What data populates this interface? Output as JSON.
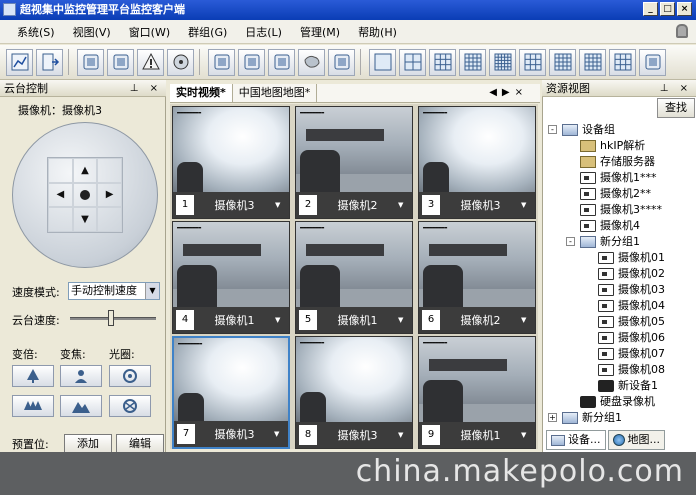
{
  "window": {
    "title": "超视集中监控管理平台监控客户端",
    "controls": [
      "_",
      "□",
      "×"
    ]
  },
  "menu": [
    "系统(S)",
    "视图(V)",
    "窗口(W)",
    "群组(G)",
    "日志(L)",
    "管理(M)",
    "帮助(H)"
  ],
  "toolbar": {
    "icons": [
      "chart-icon",
      "exit-icon",
      "log-icon",
      "edit-icon",
      "alarm-icon",
      "disk-icon",
      "settings-icon",
      "camera-add-icon",
      "device-icon",
      "map-icon",
      "export-icon",
      "layout-1-icon",
      "layout-4-icon",
      "layout-9-icon",
      "layout-16-icon",
      "layout-25-icon",
      "layout-6-icon",
      "layout-8-icon",
      "layout-13-icon",
      "layout-custom-icon",
      "more-icon"
    ]
  },
  "ptz": {
    "panel_title": "云台控制",
    "camera_label": "摄像机：摄像机3",
    "speed_mode_label": "速度模式:",
    "speed_mode_value": "手动控制速度",
    "speed_label": "云台速度:",
    "zoom_label": "变倍:",
    "focus_label": "变焦:",
    "iris_label": "光圈:",
    "preset_label": "预置位:",
    "add_button": "添加",
    "edit_button": "编辑"
  },
  "tabs": [
    {
      "label": "实时视频*",
      "active": true
    },
    {
      "label": "中国地图地图*",
      "active": false
    }
  ],
  "video_cells": [
    {
      "num": "1",
      "name": "摄像机3",
      "scene": "bright"
    },
    {
      "num": "2",
      "name": "摄像机2",
      "scene": "room"
    },
    {
      "num": "3",
      "name": "摄像机3",
      "scene": "bright"
    },
    {
      "num": "4",
      "name": "摄像机1",
      "scene": "room"
    },
    {
      "num": "5",
      "name": "摄像机1",
      "scene": "room"
    },
    {
      "num": "6",
      "name": "摄像机2",
      "scene": "room"
    },
    {
      "num": "7",
      "name": "摄像机3",
      "scene": "bright"
    },
    {
      "num": "8",
      "name": "摄像机3",
      "scene": "bright"
    },
    {
      "num": "9",
      "name": "摄像机1",
      "scene": "room"
    }
  ],
  "resources": {
    "panel_title": "资源视图",
    "search_button": "查找",
    "tree": [
      {
        "label": "设备组",
        "level": 0,
        "icon": "group",
        "expander": "-"
      },
      {
        "label": "hkIP解析",
        "level": 1,
        "icon": "server"
      },
      {
        "label": "存储服务器",
        "level": 1,
        "icon": "server"
      },
      {
        "label": "摄像机1***",
        "level": 1,
        "icon": "camera"
      },
      {
        "label": "摄像机2**",
        "level": 1,
        "icon": "camera"
      },
      {
        "label": "摄像机3****",
        "level": 1,
        "icon": "camera"
      },
      {
        "label": "摄像机4",
        "level": 1,
        "icon": "camera"
      },
      {
        "label": "新分组1",
        "level": 1,
        "icon": "group",
        "expander": "-"
      },
      {
        "label": "摄像机01",
        "level": 2,
        "icon": "camera"
      },
      {
        "label": "摄像机02",
        "level": 2,
        "icon": "camera"
      },
      {
        "label": "摄像机03",
        "level": 2,
        "icon": "camera"
      },
      {
        "label": "摄像机04",
        "level": 2,
        "icon": "camera"
      },
      {
        "label": "摄像机05",
        "level": 2,
        "icon": "camera"
      },
      {
        "label": "摄像机06",
        "level": 2,
        "icon": "camera"
      },
      {
        "label": "摄像机07",
        "level": 2,
        "icon": "camera"
      },
      {
        "label": "摄像机08",
        "level": 2,
        "icon": "camera"
      },
      {
        "label": "新设备1",
        "level": 2,
        "icon": "recorder"
      },
      {
        "label": "硬盘录像机",
        "level": 1,
        "icon": "recorder"
      },
      {
        "label": "新分组1",
        "level": 0,
        "icon": "group",
        "expander": "+"
      }
    ],
    "bottom_tabs": [
      "设备...",
      "地图..."
    ]
  },
  "watermark": "china.makepolo.com"
}
